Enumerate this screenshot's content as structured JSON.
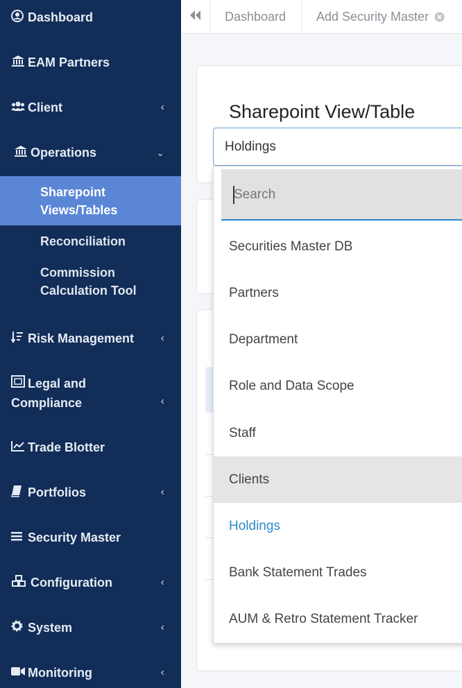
{
  "sidebar": {
    "items": [
      {
        "label": "Dashboard",
        "icon": "user-circle-icon"
      },
      {
        "label": "EAM Partners",
        "icon": "bank-icon"
      },
      {
        "label": "Client",
        "icon": "users-icon"
      },
      {
        "label": "Operations",
        "icon": "bank-icon"
      },
      {
        "label": "Risk Management",
        "icon": "sort-icon"
      },
      {
        "label": "Legal and Compliance",
        "icon": "image-icon"
      },
      {
        "label": "Trade Blotter",
        "icon": "chart-line-icon"
      },
      {
        "label": "Portfolios",
        "icon": "book-icon"
      },
      {
        "label": "Security Master",
        "icon": "bars-icon"
      },
      {
        "label": "Configuration",
        "icon": "cubes-icon"
      },
      {
        "label": "System",
        "icon": "gear-icon"
      },
      {
        "label": "Monitoring",
        "icon": "video-icon"
      }
    ],
    "operations_sub": [
      {
        "label": "Sharepoint Views/Tables",
        "active": true
      },
      {
        "label": "Reconciliation",
        "active": false
      },
      {
        "label": "Commission Calculation Tool",
        "active": false
      }
    ]
  },
  "topbar": {
    "tabs": [
      {
        "label": "Dashboard"
      },
      {
        "label": "Add Security Master"
      }
    ]
  },
  "form": {
    "title": "Sharepoint View/Table",
    "selected_value": "Holdings",
    "search_placeholder": "Search",
    "options": [
      "Securities Master DB",
      "Partners",
      "Department",
      "Role and Data Scope",
      "Staff",
      "Clients",
      "Holdings",
      "Bank Statement Trades",
      "AUM & Retro Statement Tracker"
    ],
    "hovered_option": "Clients"
  },
  "colors": {
    "sidebar_bg": "#112d58",
    "sidebar_active": "#5b86d6",
    "accent": "#2b8bc8"
  }
}
